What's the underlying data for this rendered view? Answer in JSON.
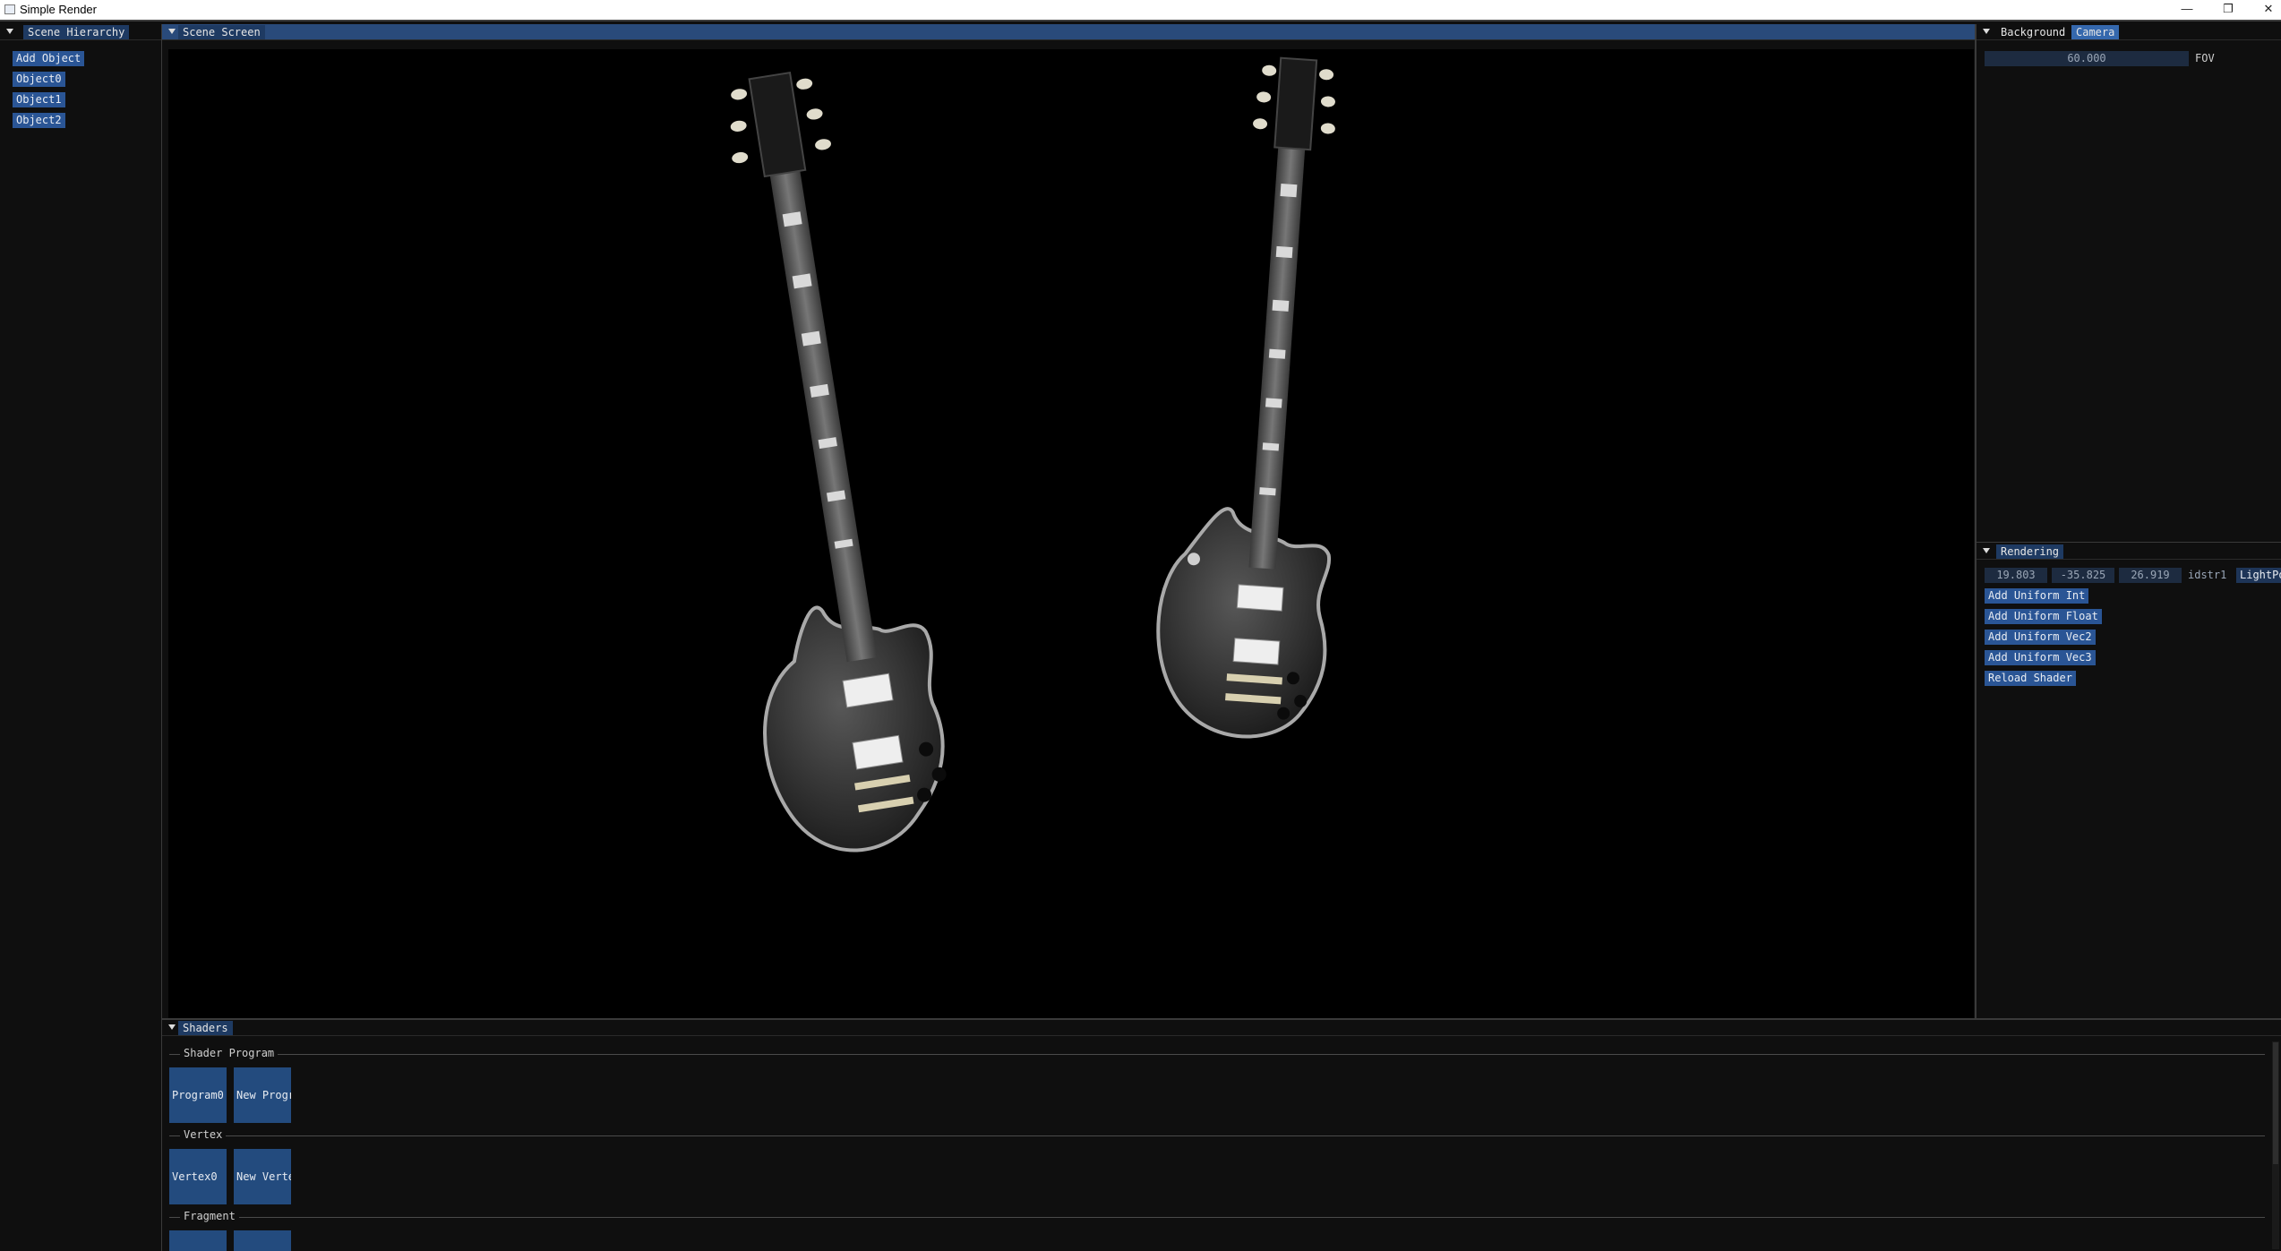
{
  "window": {
    "title": "Simple Render",
    "minimize_icon": "minimize-icon",
    "restore_icon": "restore-icon",
    "close_icon": "close-icon"
  },
  "hierarchy": {
    "tab": "Scene Hierarchy",
    "add_button": "Add Object",
    "objects": [
      "Object0",
      "Object1",
      "Object2"
    ]
  },
  "scene": {
    "tab": "Scene Screen"
  },
  "camera_panel": {
    "tabs": [
      "Background",
      "Camera"
    ],
    "selected_tab": "Camera",
    "fov_value": "60.000",
    "fov_label": "FOV"
  },
  "rendering": {
    "tab": "Rendering",
    "light_values": [
      "19.803",
      "-35.825",
      "26.919"
    ],
    "uniform_name": "idstr1",
    "uniform_label": "LightPo",
    "buttons": [
      "Add Uniform Int",
      "Add Uniform Float",
      "Add Uniform Vec2",
      "Add Uniform Vec3",
      "Reload Shader"
    ]
  },
  "shaders": {
    "tab": "Shaders",
    "sections": [
      {
        "label": "Shader Program",
        "items": [
          "Program0",
          "New Program"
        ]
      },
      {
        "label": "Vertex",
        "items": [
          "Vertex0",
          "New Vertex"
        ]
      },
      {
        "label": "Fragment",
        "items": [
          "",
          ""
        ]
      }
    ]
  },
  "colors": {
    "accent": "#294a7a",
    "button": "#2a5595",
    "background": "#0f0f0f",
    "viewport": "#000000"
  }
}
